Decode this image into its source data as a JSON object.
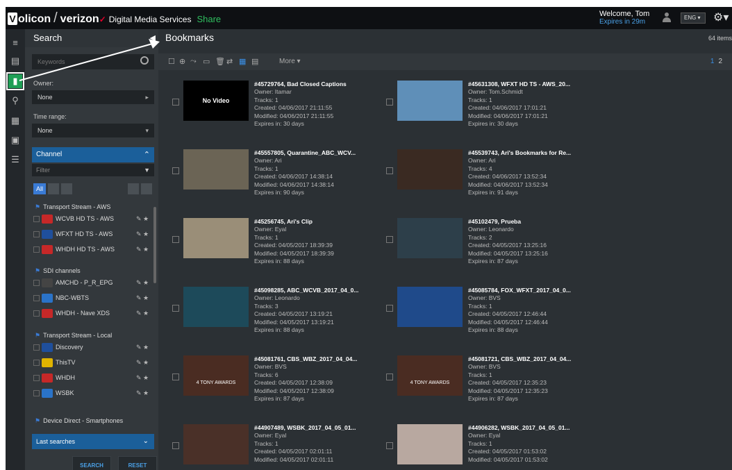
{
  "topbar": {
    "brand1": "olicon",
    "brand2": "verizon",
    "dms": "Digital Media Services",
    "share": "Share",
    "welcome": "Welcome, Tom",
    "expires": "Expires in 29m",
    "lang": "ENG ▾",
    "gear": "⚙▾"
  },
  "sidebar": {
    "title": "Search",
    "keyword_placeholder": "Keywords",
    "owner_label": "Owner:",
    "owner_value": "None",
    "time_label": "Time range:",
    "time_value": "None",
    "channel_label": "Channel",
    "filter_placeholder": "Filter",
    "all_label": "All",
    "groups": [
      {
        "name": "Transport Stream - AWS",
        "channels": [
          {
            "name": "WCVB HD TS - AWS",
            "color": "#c62828"
          },
          {
            "name": "WFXT HD TS - AWS",
            "color": "#1f4f9c"
          },
          {
            "name": "WHDH HD TS - AWS",
            "color": "#c62828"
          }
        ]
      },
      {
        "name": "SDI channels",
        "channels": [
          {
            "name": "AMCHD - P_R_EPG",
            "color": "#444"
          },
          {
            "name": "NBC-WBTS",
            "color": "#2a73c8"
          },
          {
            "name": "WHDH - Nave XDS",
            "color": "#c62828"
          }
        ]
      },
      {
        "name": "Transport Stream - Local",
        "channels": [
          {
            "name": "Discovery",
            "color": "#1f4f9c"
          },
          {
            "name": "ThisTV",
            "color": "#e0b400"
          },
          {
            "name": "WHDH",
            "color": "#c62828"
          },
          {
            "name": "WSBK",
            "color": "#2a73c8"
          }
        ]
      }
    ],
    "group4": "Device Direct - Smartphones",
    "last_searches": "Last searches",
    "search_btn": "SEARCH",
    "reset_btn": "RESET"
  },
  "main": {
    "title": "Bookmarks",
    "items_count": "64 items",
    "more": "More ▾",
    "page1": "1",
    "page2": "2"
  },
  "bookmarks": [
    {
      "title": "#45729764, Bad Closed Captions",
      "owner": "Owner: Itamar",
      "tracks": "Tracks: 1",
      "created": "Created: 04/06/2017 21:11:55",
      "modified": "Modified: 04/06/2017 21:11:55",
      "expires": "Expires in: 30 days",
      "thumb_text": "No Video",
      "thumb_color": "#000"
    },
    {
      "title": "#45631308, WFXT HD TS - AWS_20...",
      "owner": "Owner: Tom.Schmidt",
      "tracks": "Tracks: 1",
      "created": "Created: 04/06/2017 17:01:21",
      "modified": "Modified: 04/06/2017 17:01:21",
      "expires": "Expires in: 30 days",
      "thumb_text": "",
      "thumb_color": "#5f8fb8"
    },
    {
      "title": "#45557805, Quarantine_ABC_WCV...",
      "owner": "Owner: Ari",
      "tracks": "Tracks: 1",
      "created": "Created: 04/06/2017 14:38:14",
      "modified": "Modified: 04/06/2017 14:38:14",
      "expires": "Expires in: 90 days",
      "thumb_text": "",
      "thumb_color": "#6b6455"
    },
    {
      "title": "#45539743, Ari's Bookmarks for Re...",
      "owner": "Owner: Ari",
      "tracks": "Tracks: 4",
      "created": "Created: 04/06/2017 13:52:34",
      "modified": "Modified: 04/06/2017 13:52:34",
      "expires": "Expires in: 91 days",
      "thumb_text": "",
      "thumb_color": "#3a2a22"
    },
    {
      "title": "#45256745, Ari's Clip",
      "owner": "Owner: Eyal",
      "tracks": "Tracks: 1",
      "created": "Created: 04/05/2017 18:39:39",
      "modified": "Modified: 04/05/2017 18:39:39",
      "expires": "Expires in: 88 days",
      "thumb_text": "",
      "thumb_color": "#9a8e78"
    },
    {
      "title": "#45102479, Prueba",
      "owner": "Owner: Leonardo",
      "tracks": "Tracks: 2",
      "created": "Created: 04/05/2017 13:25:16",
      "modified": "Modified: 04/05/2017 13:25:16",
      "expires": "Expires in: 87 days",
      "thumb_text": "",
      "thumb_color": "#2d3f4a"
    },
    {
      "title": "#45098285, ABC_WCVB_2017_04_0...",
      "owner": "Owner: Leonardo",
      "tracks": "Tracks: 3",
      "created": "Created: 04/05/2017 13:19:21",
      "modified": "Modified: 04/05/2017 13:19:21",
      "expires": "Expires in: 88 days",
      "thumb_text": "",
      "thumb_color": "#1d4a5a"
    },
    {
      "title": "#45085784, FOX_WFXT_2017_04_0...",
      "owner": "Owner: BVS",
      "tracks": "Tracks: 1",
      "created": "Created: 04/05/2017 12:46:44",
      "modified": "Modified: 04/05/2017 12:46:44",
      "expires": "Expires in: 88 days",
      "thumb_text": "",
      "thumb_color": "#1f4a8a"
    },
    {
      "title": "#45081761, CBS_WBZ_2017_04_04...",
      "owner": "Owner: BVS",
      "tracks": "Tracks: 6",
      "created": "Created: 04/05/2017 12:38:09",
      "modified": "Modified: 04/05/2017 12:38:09",
      "expires": "Expires in: 87 days",
      "thumb_text": "4 TONY AWARDS",
      "thumb_color": "#4a2c22"
    },
    {
      "title": "#45081721, CBS_WBZ_2017_04_04...",
      "owner": "Owner: BVS",
      "tracks": "Tracks: 1",
      "created": "Created: 04/05/2017 12:35:23",
      "modified": "Modified: 04/05/2017 12:35:23",
      "expires": "Expires in: 87 days",
      "thumb_text": "4 TONY AWARDS",
      "thumb_color": "#4a2c22"
    },
    {
      "title": "#44907489, WSBK_2017_04_05_01...",
      "owner": "Owner: Eyal",
      "tracks": "Tracks: 1",
      "created": "Created: 04/05/2017 02:01:11",
      "modified": "Modified: 04/05/2017 02:01:11",
      "expires": "",
      "thumb_text": "",
      "thumb_color": "#4a3028"
    },
    {
      "title": "#44906282, WSBK_2017_04_05_01...",
      "owner": "Owner: Eyal",
      "tracks": "Tracks: 1",
      "created": "Created: 04/05/2017 01:53:02",
      "modified": "Modified: 04/05/2017 01:53:02",
      "expires": "",
      "thumb_text": "",
      "thumb_color": "#b8a8a0"
    }
  ]
}
